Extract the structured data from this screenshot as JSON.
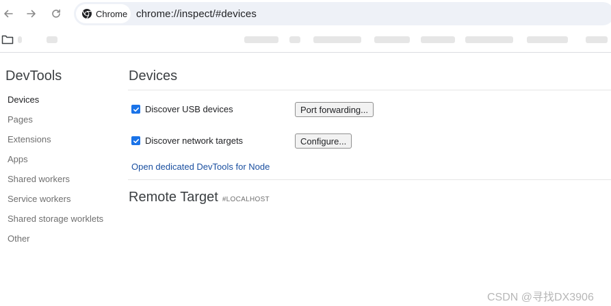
{
  "browser": {
    "chip_label": "Chrome",
    "url": "chrome://inspect/#devices"
  },
  "sidebar": {
    "title": "DevTools",
    "items": [
      {
        "label": "Devices",
        "active": true
      },
      {
        "label": "Pages",
        "active": false
      },
      {
        "label": "Extensions",
        "active": false
      },
      {
        "label": "Apps",
        "active": false
      },
      {
        "label": "Shared workers",
        "active": false
      },
      {
        "label": "Service workers",
        "active": false
      },
      {
        "label": "Shared storage worklets",
        "active": false
      },
      {
        "label": "Other",
        "active": false
      }
    ]
  },
  "main": {
    "title": "Devices",
    "usb": {
      "label": "Discover USB devices",
      "checked": true,
      "button": "Port forwarding..."
    },
    "network": {
      "label": "Discover network targets",
      "checked": true,
      "button": "Configure..."
    },
    "node_link": "Open dedicated DevTools for Node",
    "remote_title": "Remote Target",
    "remote_tag": "#LOCALHOST"
  },
  "watermark": "CSDN @寻找DX3906",
  "colors": {
    "accent": "#1a73e8",
    "link": "#1a4fa0"
  }
}
